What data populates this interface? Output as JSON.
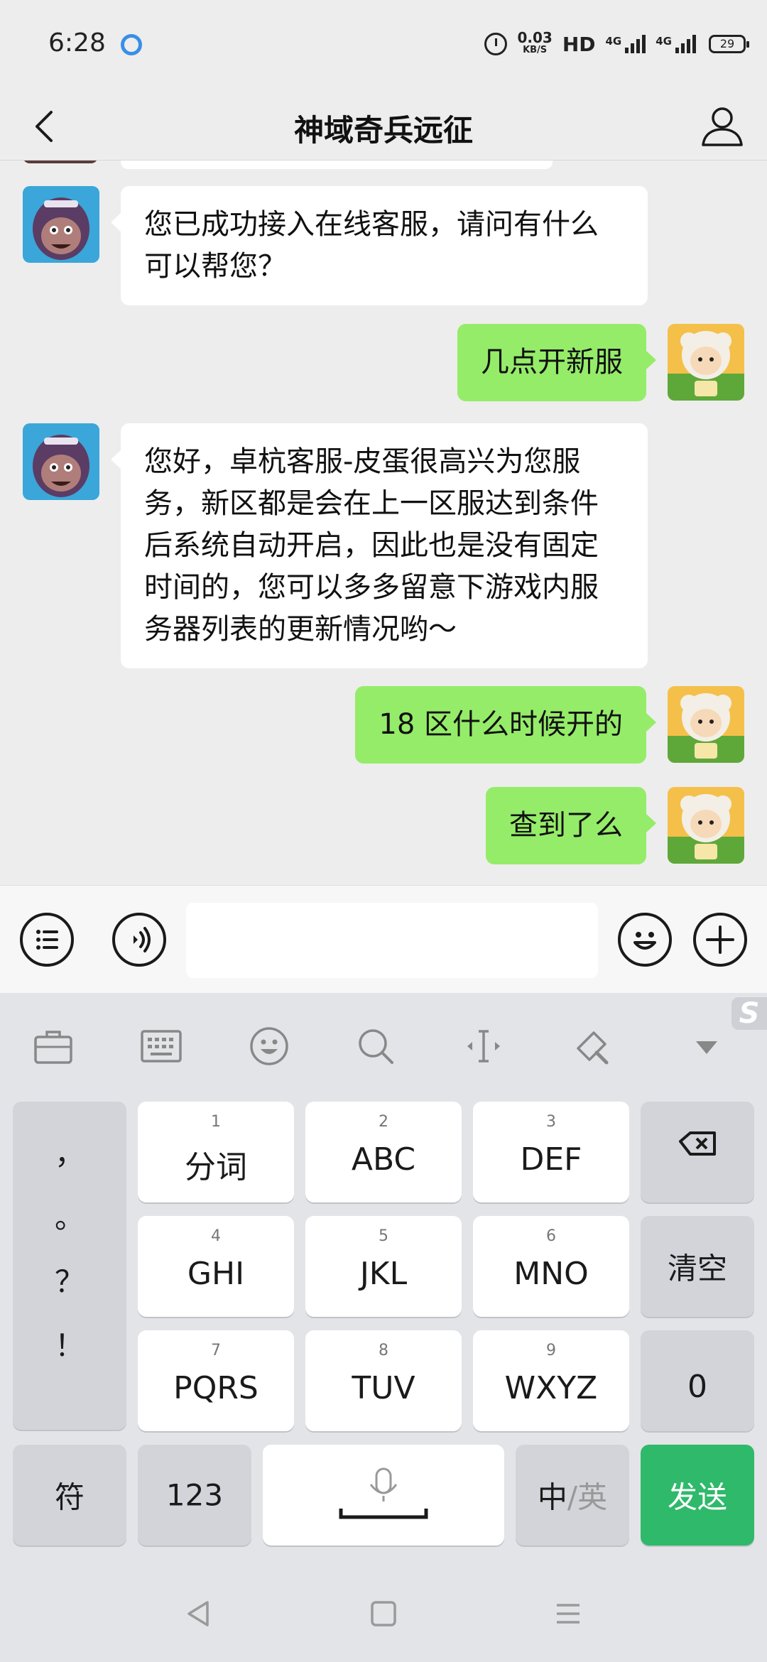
{
  "status_bar": {
    "time": "6:28",
    "speed_value": "0.03",
    "speed_unit": "KB/S",
    "hd": "HD",
    "net1": "4G",
    "net2": "4G",
    "battery": "29"
  },
  "header": {
    "title": "神域奇兵远征"
  },
  "messages": [
    {
      "side": "left",
      "text": "您已成功接入在线客服，请问有什么可以帮您？"
    },
    {
      "side": "right",
      "text": "几点开新服"
    },
    {
      "side": "left",
      "text": "您好，卓杭客服-皮蛋很高兴为您服务，新区都是会在上一区服达到条件后系统自动开启，因此也是没有固定时间的，您可以多多留意下游戏内服务器列表的更新情况哟～"
    },
    {
      "side": "right",
      "text": "18 区什么时候开的"
    },
    {
      "side": "right",
      "text": "查到了么"
    }
  ],
  "input": {
    "value": ""
  },
  "keyboard": {
    "badge": "S",
    "punctuation": [
      "，",
      "。",
      "？",
      "！"
    ],
    "keys": [
      {
        "num": "1",
        "label": "分词"
      },
      {
        "num": "2",
        "label": "ABC"
      },
      {
        "num": "3",
        "label": "DEF"
      },
      {
        "num": "4",
        "label": "GHI"
      },
      {
        "num": "5",
        "label": "JKL"
      },
      {
        "num": "6",
        "label": "MNO"
      },
      {
        "num": "7",
        "label": "PQRS"
      },
      {
        "num": "8",
        "label": "TUV"
      },
      {
        "num": "9",
        "label": "WXYZ"
      }
    ],
    "clear": "清空",
    "zero": "0",
    "symbols": "符",
    "numbers": "123",
    "lang_zh": "中",
    "lang_sep": "/",
    "lang_en": "英",
    "send": "发送"
  },
  "colors": {
    "sent_bubble": "#95ec69",
    "send_key": "#2fb96a",
    "background": "#ededed"
  }
}
